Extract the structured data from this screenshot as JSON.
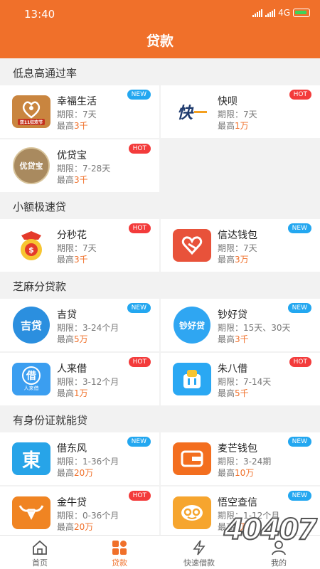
{
  "status_bar": {
    "time": "13:40",
    "network": "4G"
  },
  "header": {
    "title": "贷款"
  },
  "sections": [
    {
      "title": "低息高通过率"
    },
    {
      "title": "小额极速贷"
    },
    {
      "title": "芝麻分贷款"
    },
    {
      "title": "有身份证就能贷"
    }
  ],
  "cards": [
    {
      "name": "幸福生活",
      "term": "期限：7天",
      "max_prefix": "最高",
      "max_amount": "3千",
      "badge": "NEW",
      "logo_color": "#c9853f",
      "logo_caption": "双11狂欢节"
    },
    {
      "name": "快呗",
      "term": "期限：7天",
      "max_prefix": "最高",
      "max_amount": "1万",
      "badge": "HOT",
      "logo_color": "#ffffff",
      "logo_text": "快"
    },
    {
      "name": "优贷宝",
      "term": "期限：7-28天",
      "max_prefix": "最高",
      "max_amount": "3千",
      "badge": "HOT",
      "logo_color": "#a98a5f",
      "logo_text": "优贷宝"
    },
    {
      "name": "分秒花",
      "term": "期限：7天",
      "max_prefix": "最高",
      "max_amount": "3千",
      "badge": "HOT",
      "logo_color": "#f7c531"
    },
    {
      "name": "信达钱包",
      "term": "期限：7天",
      "max_prefix": "最高",
      "max_amount": "3万",
      "badge": "NEW",
      "logo_color": "#e8523a"
    },
    {
      "name": "吉贷",
      "term": "期限：3-24个月",
      "max_prefix": "最高",
      "max_amount": "5万",
      "badge": "NEW",
      "logo_color": "#2b8fdf",
      "logo_text": "吉贷"
    },
    {
      "name": "钞好贷",
      "term": "期限：15天、30天",
      "max_prefix": "最高",
      "max_amount": "3千",
      "badge": "NEW",
      "logo_color": "#2fa6f2",
      "logo_text": "钞好贷"
    },
    {
      "name": "人来借",
      "term": "期限：3-12个月",
      "max_prefix": "最高",
      "max_amount": "1万",
      "badge": "HOT",
      "logo_color": "#3b9ef0",
      "logo_text": "借",
      "logo_caption": "人来借"
    },
    {
      "name": "朱八借",
      "term": "期限：7-14天",
      "max_prefix": "最高",
      "max_amount": "5千",
      "badge": "HOT",
      "logo_color": "#2aa8f3"
    },
    {
      "name": "借东风",
      "term": "期限：1-36个月",
      "max_prefix": "最高",
      "max_amount": "20万",
      "badge": "NEW",
      "logo_color": "#27a4e8",
      "logo_text": "東"
    },
    {
      "name": "麦芒钱包",
      "term": "期限：3-24期",
      "max_prefix": "最高",
      "max_amount": "10万",
      "badge": "NEW",
      "logo_color": "#f36e1f"
    },
    {
      "name": "金牛贷",
      "term": "期限：0-36个月",
      "max_prefix": "最高",
      "max_amount": "20万",
      "badge": "HOT",
      "logo_color": "#f08422"
    },
    {
      "name": "悟空查信",
      "term": "期限：1-12个月",
      "max_prefix": "最高",
      "max_amount": "1万",
      "badge": "NEW",
      "logo_color": "#f6a52e"
    }
  ],
  "tabs": [
    {
      "label": "首页",
      "icon": "home-icon"
    },
    {
      "label": "贷款",
      "icon": "grid-icon"
    },
    {
      "label": "快速借款",
      "icon": "lightning-icon"
    },
    {
      "label": "我的",
      "icon": "user-icon"
    }
  ],
  "watermark": "40407",
  "colors": {
    "brand": "#f0702a",
    "new_badge": "#23a7f0",
    "hot_badge": "#f33b3b"
  }
}
